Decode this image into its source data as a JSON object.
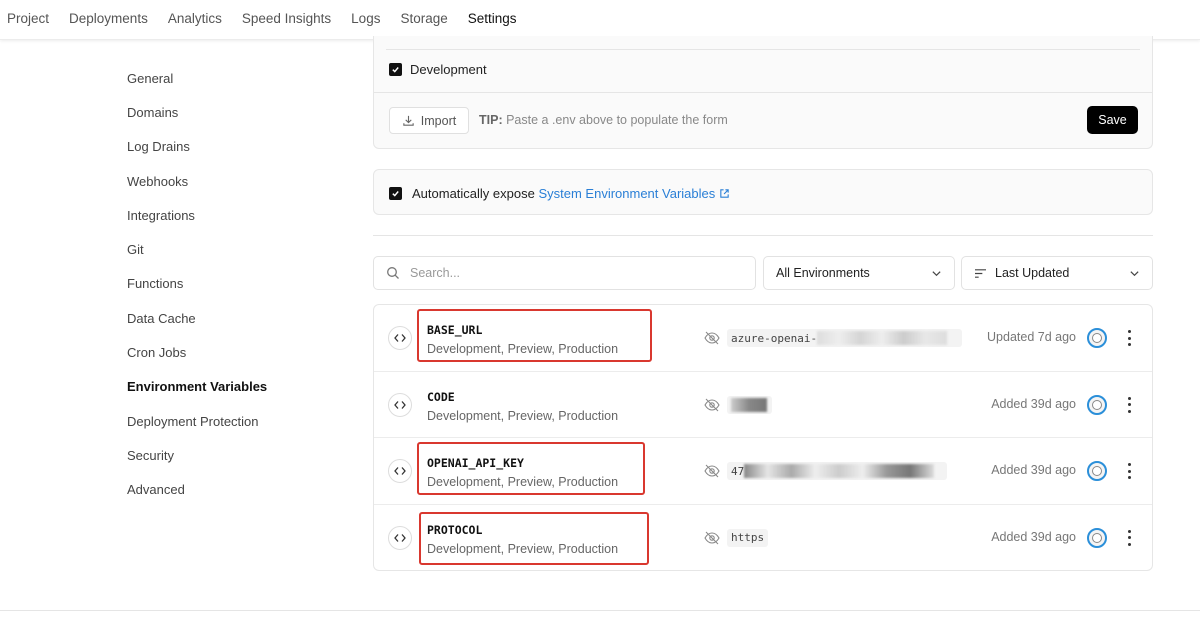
{
  "nav": {
    "tabs": [
      {
        "label": "Project"
      },
      {
        "label": "Deployments"
      },
      {
        "label": "Analytics"
      },
      {
        "label": "Speed Insights"
      },
      {
        "label": "Logs"
      },
      {
        "label": "Storage"
      },
      {
        "label": "Settings",
        "active": true
      }
    ]
  },
  "sidebar": {
    "items": [
      {
        "label": "General"
      },
      {
        "label": "Domains"
      },
      {
        "label": "Log Drains"
      },
      {
        "label": "Webhooks"
      },
      {
        "label": "Integrations"
      },
      {
        "label": "Git"
      },
      {
        "label": "Functions"
      },
      {
        "label": "Data Cache"
      },
      {
        "label": "Cron Jobs"
      },
      {
        "label": "Environment Variables",
        "active": true
      },
      {
        "label": "Deployment Protection"
      },
      {
        "label": "Security"
      },
      {
        "label": "Advanced"
      }
    ]
  },
  "form": {
    "development_label": "Development",
    "development_checked": true,
    "import_label": "Import",
    "tip_prefix": "TIP:",
    "tip_text": "Paste a .env above to populate the form",
    "save_label": "Save"
  },
  "expose": {
    "checked": true,
    "text": "Automatically expose",
    "link_text": "System Environment Variables"
  },
  "filters": {
    "search_placeholder": "Search...",
    "environment": "All Environments",
    "sort": "Last Updated"
  },
  "variables": [
    {
      "name": "BASE_URL",
      "envs": "Development, Preview, Production",
      "value": "azure-openai-",
      "updated": "Updated 7d ago"
    },
    {
      "name": "CODE",
      "envs": "Development, Preview, Production",
      "value": "",
      "updated": "Added 39d ago"
    },
    {
      "name": "OPENAI_API_KEY",
      "envs": "Development, Preview, Production",
      "value": "47",
      "updated": "Added 39d ago"
    },
    {
      "name": "PROTOCOL",
      "envs": "Development, Preview, Production",
      "value": "https",
      "updated": "Added 39d ago"
    }
  ],
  "colors": {
    "accent_link": "#2a7fd6",
    "highlight_box": "#d9382f",
    "avatar_ring": "#2b8fd9"
  }
}
